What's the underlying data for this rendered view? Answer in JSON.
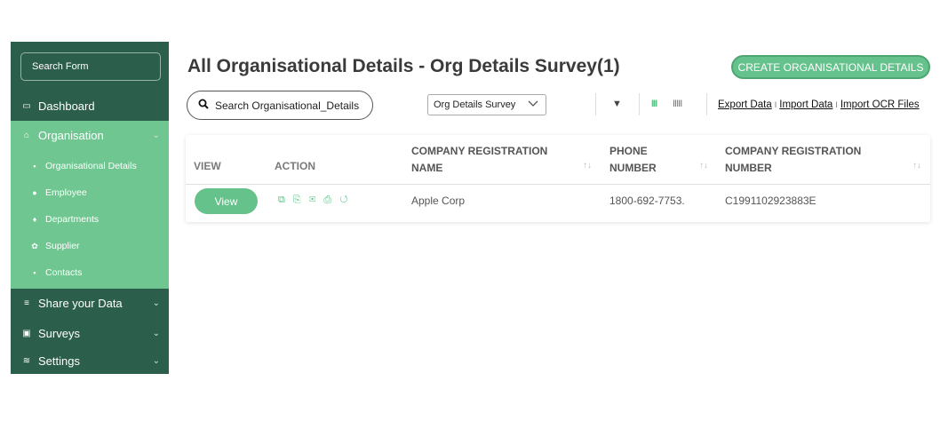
{
  "sidebar": {
    "search_label": "Search Form",
    "items": [
      {
        "label": "Dashboard",
        "icon": "dashboard-icon",
        "glyph": "▭"
      },
      {
        "label": "Organisation",
        "icon": "bank-icon",
        "glyph": "⌂",
        "chevron": "⌄"
      },
      {
        "label": "Share your Data",
        "icon": "database-icon",
        "glyph": "≡",
        "chevron": "⌄"
      },
      {
        "label": "Surveys",
        "icon": "clipboard-icon",
        "glyph": "▣",
        "chevron": "⌄"
      },
      {
        "label": "Settings",
        "icon": "sliders-icon",
        "glyph": "≋",
        "chevron": "⌄"
      }
    ],
    "subitems": [
      {
        "label": "Organisational Details",
        "icon": "document-icon",
        "glyph": "▪"
      },
      {
        "label": "Employee",
        "icon": "user-icon",
        "glyph": "●"
      },
      {
        "label": "Departments",
        "icon": "person-icon",
        "glyph": "♦"
      },
      {
        "label": "Supplier",
        "icon": "supplier-icon",
        "glyph": "✿"
      },
      {
        "label": "Contacts",
        "icon": "contacts-icon",
        "glyph": "▪"
      }
    ]
  },
  "header": {
    "title": "All Organisational Details - Org Details Survey(1)",
    "create_label": "CREATE ORGANISATIONAL DETAILS"
  },
  "toolbar": {
    "search_label": "Search Organisational_Details",
    "select_value": "Org Details Survey",
    "filter_glyph": "▼",
    "view_cols_glyph": "III",
    "view_rows_glyph": "IIIII",
    "export_label": "Export Data",
    "import_label": "Import Data",
    "import_ocr_label": "Import OCR Files",
    "link_sep": "I"
  },
  "table": {
    "columns": {
      "view": "VIEW",
      "action": "ACTION",
      "name_l1": "COMPANY REGISTRATION",
      "name_l2": "NAME",
      "phone_l1": "PHONE",
      "phone_l2": "NUMBER",
      "reg_l1": "COMPANY REGISTRATION",
      "reg_l2": "NUMBER"
    },
    "sort_glyph": "↑↓",
    "rows": [
      {
        "view_label": "View",
        "action_glyphs": "⧉ ⎘ ✉ ⎙ ↺",
        "company_name": "Apple Corp",
        "phone": "1800-692-7753.",
        "reg_number": "C1991102923883E"
      }
    ]
  },
  "colors": {
    "sidebar_dark": "#2c5e4c",
    "sidebar_active": "#6fc690",
    "accent": "#64c28a"
  }
}
